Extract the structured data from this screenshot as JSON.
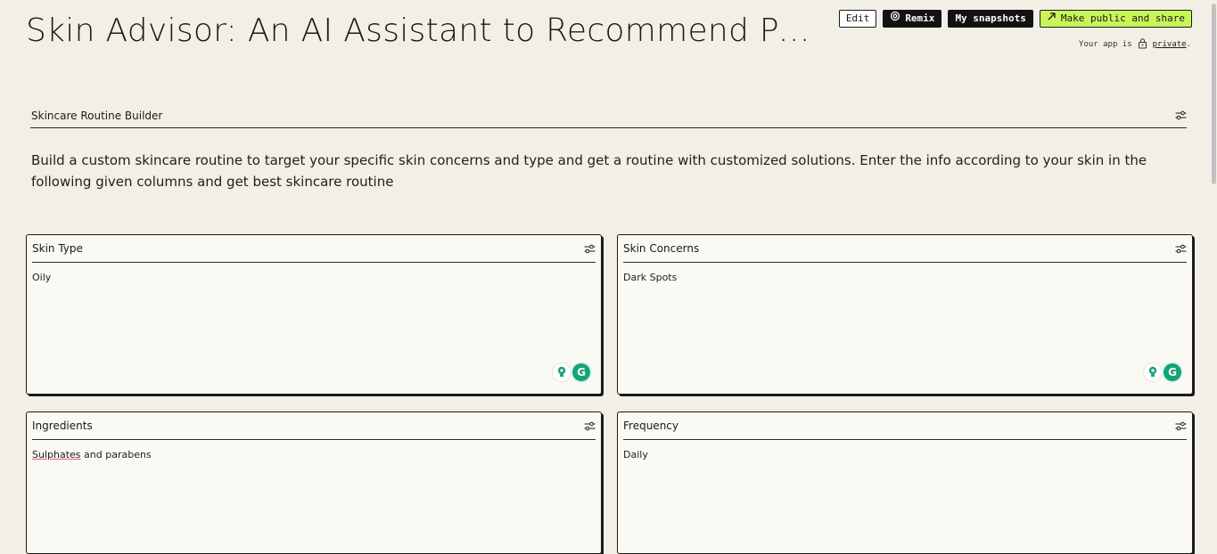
{
  "header": {
    "title": "Skin Advisor: An AI Assistant to Recommend Pers…",
    "actions": {
      "edit_label": "Edit",
      "remix_label": "Remix",
      "snapshots_label": "My snapshots",
      "share_label": "Make public and share"
    },
    "privacy": {
      "prefix": "Your app is",
      "link": "private",
      "suffix": "."
    }
  },
  "section": {
    "title": "Skincare Routine Builder",
    "description": "Build a custom skincare routine to target your specific skin concerns and type and get a routine with customized solutions. Enter the info according to your skin in the following given columns and get best skincare routine"
  },
  "fields": {
    "skin_type": {
      "label": "Skin Type",
      "value": "Oily"
    },
    "skin_concerns": {
      "label": "Skin Concerns",
      "value": "Dark Spots"
    },
    "ingredients": {
      "label": "Ingredients",
      "value_misspelled": "Sulphates",
      "value_rest": " and parabens"
    },
    "frequency": {
      "label": "Frequency",
      "value": "Daily"
    }
  },
  "grammarly_badge": {
    "letter": "G"
  },
  "icons": [
    "remix-icon",
    "arrow-right-icon",
    "lock-icon",
    "settings-sliders-icon",
    "lightbulb-icon",
    "grammarly-icon"
  ],
  "colors": {
    "background": "#f2f0e6",
    "card": "#faf9f4",
    "accent_green": "#c9f558",
    "dark": "#121212",
    "grammarly": "#15a37a"
  }
}
